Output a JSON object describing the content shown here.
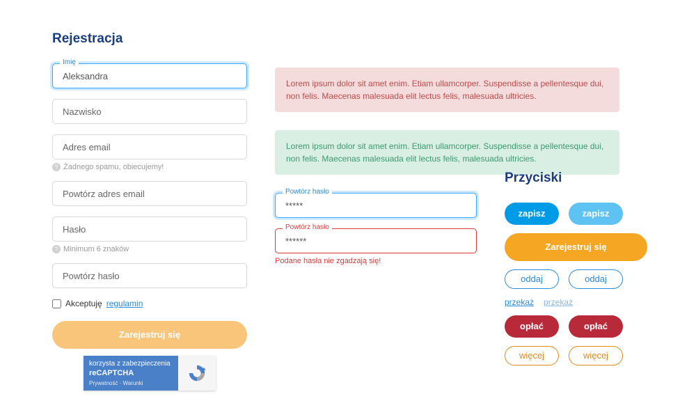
{
  "heading_register": "Rejestracja",
  "heading_buttons": "Przyciski",
  "form": {
    "first_name_label": "Imię",
    "first_name_value": "Aleksandra",
    "last_name_ph": "Nazwisko",
    "email_ph": "Adres email",
    "email_hint": "Żadnego spamu, obiecujemy!",
    "email_repeat_ph": "Powtórz adres email",
    "password_ph": "Hasło",
    "password_hint": "Minimum 6 znaków",
    "password_repeat_ph": "Powtórz hasło",
    "accept_text": "Akceptuję",
    "terms_link": "regulamin",
    "submit_label": "Zarejestruj się"
  },
  "recaptcha": {
    "line1": "korzysta z zabezpieczenia",
    "line2": "reCAPTCHA",
    "line3": "Prywatność · Warunki"
  },
  "alert_error": "Lorem ipsum dolor sit amet enim. Etiam ullamcorper. Suspendisse a pellentesque dui, non felis. Maecenas malesuada elit lectus felis, malesuada ultricies.",
  "alert_success": "Lorem ipsum dolor sit amet enim. Etiam ullamcorper. Suspendisse a pellentesque dui, non felis. Maecenas malesuada elit lectus felis, malesuada ultricies.",
  "pw_demo": {
    "label1": "Powtórz hasło",
    "value1": "*****",
    "label2": "Powtórz hasło",
    "value2": "******",
    "error_msg": "Podane hasła nie zgadzają się!"
  },
  "buttons": {
    "save": "zapisz",
    "register": "Zarejestruj się",
    "return": "oddaj",
    "transfer": "przekaż",
    "pay": "opłać",
    "more": "więcej"
  }
}
